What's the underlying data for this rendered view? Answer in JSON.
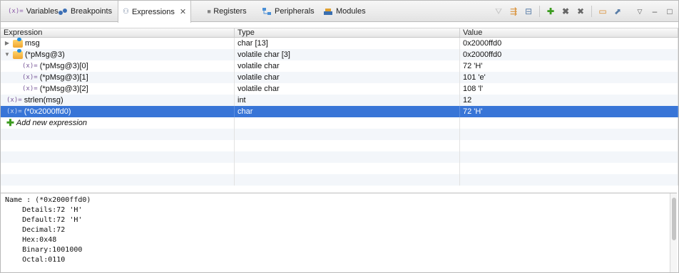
{
  "tabs": [
    {
      "label": "Variables",
      "icon": "(x)="
    },
    {
      "label": "Breakpoints",
      "icon": "breakpoint"
    },
    {
      "label": "Expressions",
      "icon": "expressions"
    },
    {
      "label": "Registers",
      "icon": "1010"
    },
    {
      "label": "Peripherals",
      "icon": "peripherals"
    },
    {
      "label": "Modules",
      "icon": "modules"
    }
  ],
  "columns": {
    "expression": "Expression",
    "type": "Type",
    "value": "Value"
  },
  "rows": [
    {
      "expression": "msg",
      "type": "char [13]",
      "value": "0x2000ffd0"
    },
    {
      "expression": "(*pMsg@3)",
      "type": "volatile char [3]",
      "value": "0x2000ffd0"
    },
    {
      "expression": "(*pMsg@3)[0]",
      "type": "volatile char",
      "value": "72 'H'"
    },
    {
      "expression": "(*pMsg@3)[1]",
      "type": "volatile char",
      "value": "101 'e'"
    },
    {
      "expression": "(*pMsg@3)[2]",
      "type": "volatile char",
      "value": "108 'l'"
    },
    {
      "expression": "strlen(msg)",
      "type": "int",
      "value": "12"
    },
    {
      "expression": "(*0x2000ffd0)",
      "type": "char",
      "value": "72 'H'"
    }
  ],
  "add_expression_label": "Add new expression",
  "var_icon": "(x)=",
  "details": {
    "name": "Name : (*0x2000ffd0)",
    "lines": [
      "Details:72 'H'",
      "Default:72 'H'",
      "Decimal:72",
      "Hex:0x48",
      "Binary:1001000",
      "Octal:0110"
    ]
  },
  "colors": {
    "selection": "#3875d7",
    "add_icon": "#3b9b1f",
    "folder": "#f0a630"
  }
}
